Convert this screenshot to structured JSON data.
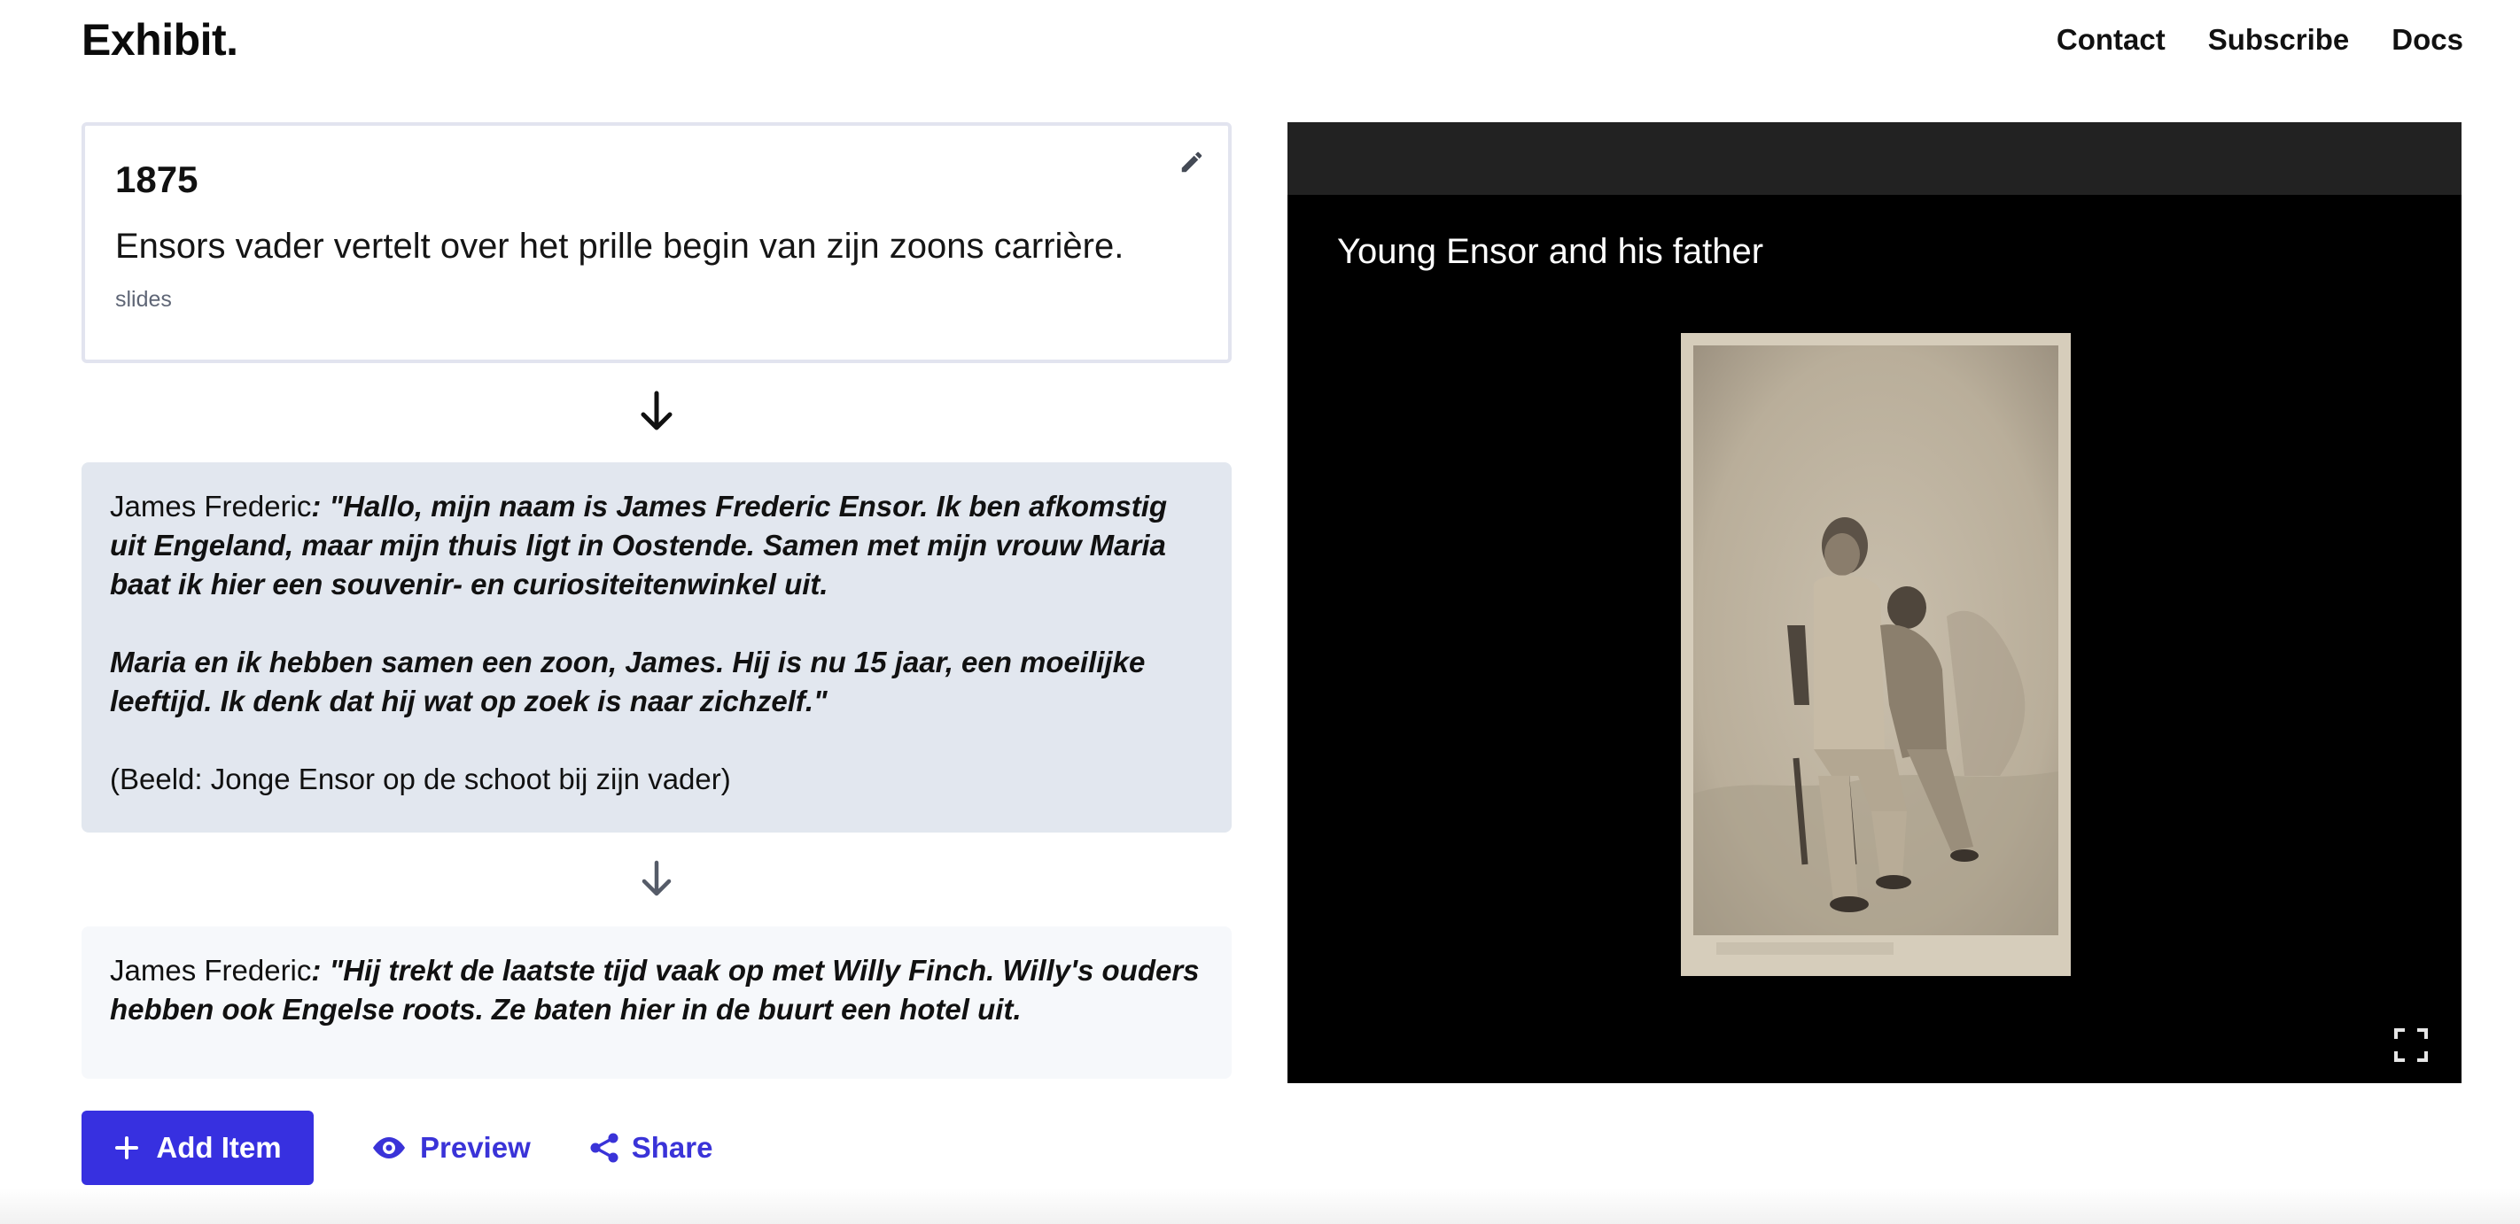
{
  "header": {
    "brand": "Exhibit.",
    "nav": [
      "Contact",
      "Subscribe",
      "Docs"
    ]
  },
  "slides_card": {
    "year": "1875",
    "description": "Ensors vader vertelt over het prille begin van zijn zoons carrière.",
    "type": "slides",
    "edit_icon": "pencil-icon"
  },
  "quote_card_1": {
    "speaker": "James Frederic",
    "separator": ": \"",
    "paragraph1": "Hallo, mijn naam is James Frederic Ensor. Ik ben afkomstig uit Engeland, maar mijn thuis ligt in Oostende. Samen met mijn vrouw Maria baat ik hier een souvenir- en curiositeitenwinkel uit.",
    "paragraph2": "Maria en ik hebben samen een zoon, James. Hij is nu 15 jaar, een moeilijke leeftijd. Ik denk dat hij wat op zoek is naar zichzelf.\"",
    "caption": "(Beeld: Jonge Ensor op de schoot bij zijn vader)"
  },
  "quote_card_2": {
    "speaker": "James Frederic",
    "separator": ": ",
    "text": "\"Hij trekt de laatste tijd vaak op met Willy Finch. Willy's ouders hebben ook Engelse roots. Ze baten hier in de buurt een hotel uit."
  },
  "actions": {
    "add_item": "Add Item",
    "preview": "Preview",
    "share": "Share"
  },
  "viewer": {
    "title": "Young Ensor and his father",
    "fullscreen_icon": "fullscreen-icon",
    "colors": {
      "bar": "#222222",
      "background": "#000000"
    }
  },
  "colors": {
    "accent": "#3730e0",
    "quote_card_bg": "#e2e7ef",
    "quote_card2_bg": "#f6f8fb"
  }
}
